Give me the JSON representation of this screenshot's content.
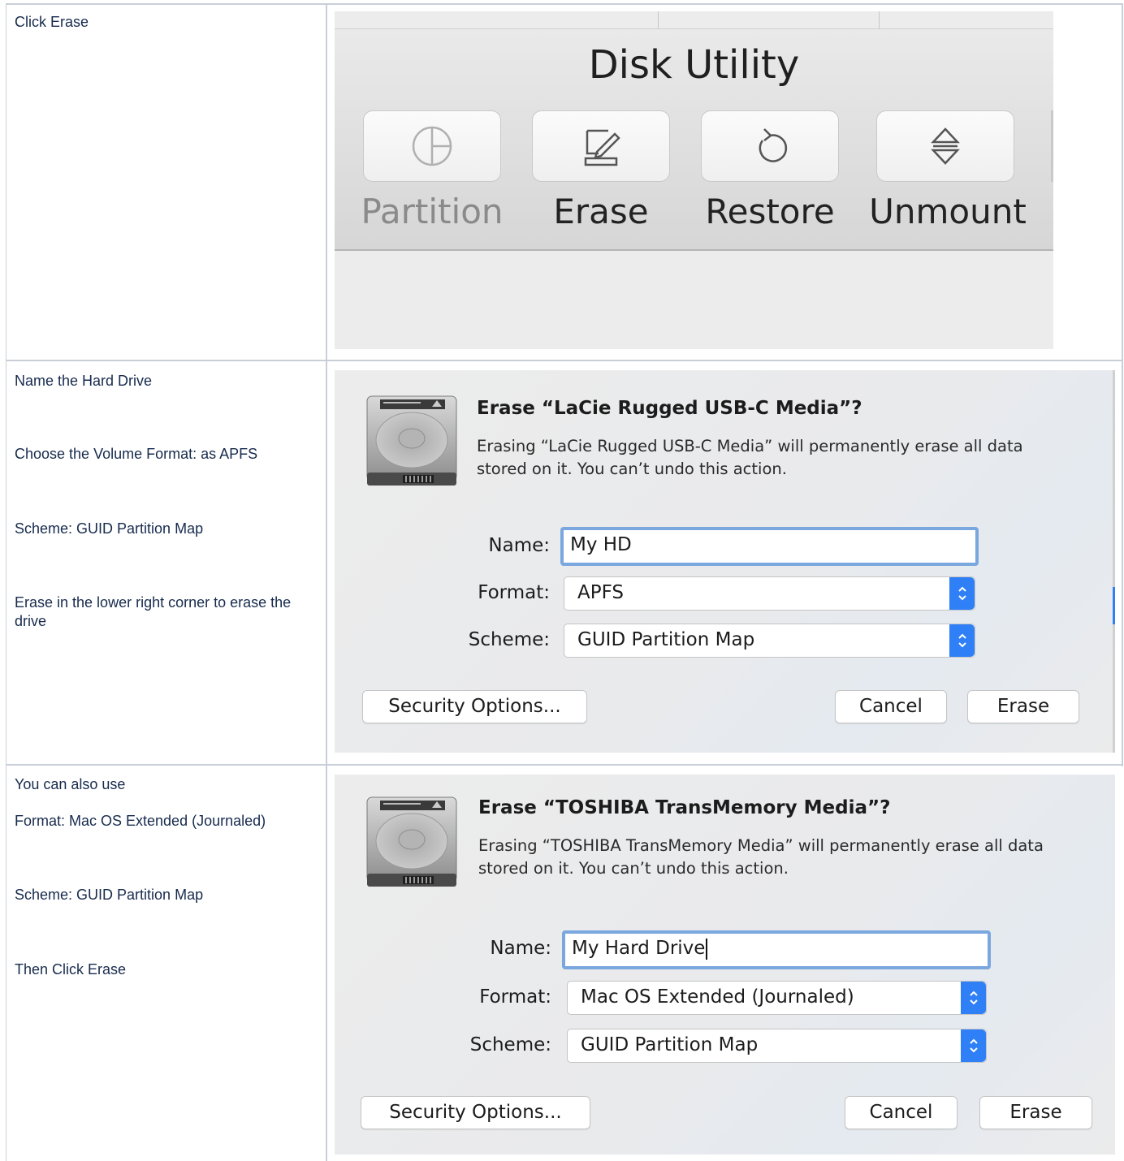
{
  "rows": [
    {
      "instructions": [
        "Click Erase"
      ]
    },
    {
      "instructions": [
        "Name the Hard Drive",
        "Choose the Volume Format: as APFS",
        "Scheme: GUID Partition Map",
        "Erase in the lower right corner to erase the drive"
      ]
    },
    {
      "instructions": [
        "You can also use",
        "Format: Mac OS Extended (Journaled)",
        "Scheme: GUID Partition Map",
        "Then Click Erase"
      ]
    }
  ],
  "toolbar": {
    "title": "Disk Utility",
    "buttons": [
      {
        "label": "Partition",
        "icon": "partition-icon",
        "enabled": false
      },
      {
        "label": "Erase",
        "icon": "erase-icon",
        "enabled": true
      },
      {
        "label": "Restore",
        "icon": "restore-icon",
        "enabled": true
      },
      {
        "label": "Unmount",
        "icon": "unmount-icon",
        "enabled": true
      }
    ]
  },
  "dialog1": {
    "title": "Erase “LaCie Rugged USB-C Media”?",
    "message_line1": "Erasing “LaCie Rugged USB-C Media” will permanently erase all data",
    "message_line2": "stored on it. You can’t undo this action.",
    "name_label": "Name:",
    "name_value": "My HD",
    "format_label": "Format:",
    "format_value": "APFS",
    "scheme_label": "Scheme:",
    "scheme_value": "GUID Partition Map",
    "security_button": "Security Options...",
    "cancel_button": "Cancel",
    "erase_button": "Erase"
  },
  "dialog2": {
    "title": "Erase “TOSHIBA TransMemory Media”?",
    "message_line1": "Erasing “TOSHIBA TransMemory Media” will permanently erase all data",
    "message_line2": "stored on it. You can’t undo this action.",
    "name_label": "Name:",
    "name_value": "My Hard Drive",
    "format_label": "Format:",
    "format_value": "Mac OS Extended (Journaled)",
    "scheme_label": "Scheme:",
    "scheme_value": "GUID Partition Map",
    "security_button": "Security Options...",
    "cancel_button": "Cancel",
    "erase_button": "Erase"
  },
  "colors": {
    "accent": "#2f7ff6",
    "focus_ring": "#7aa7de",
    "grid_line": "#c9cfd8",
    "text": "#172b4d"
  }
}
